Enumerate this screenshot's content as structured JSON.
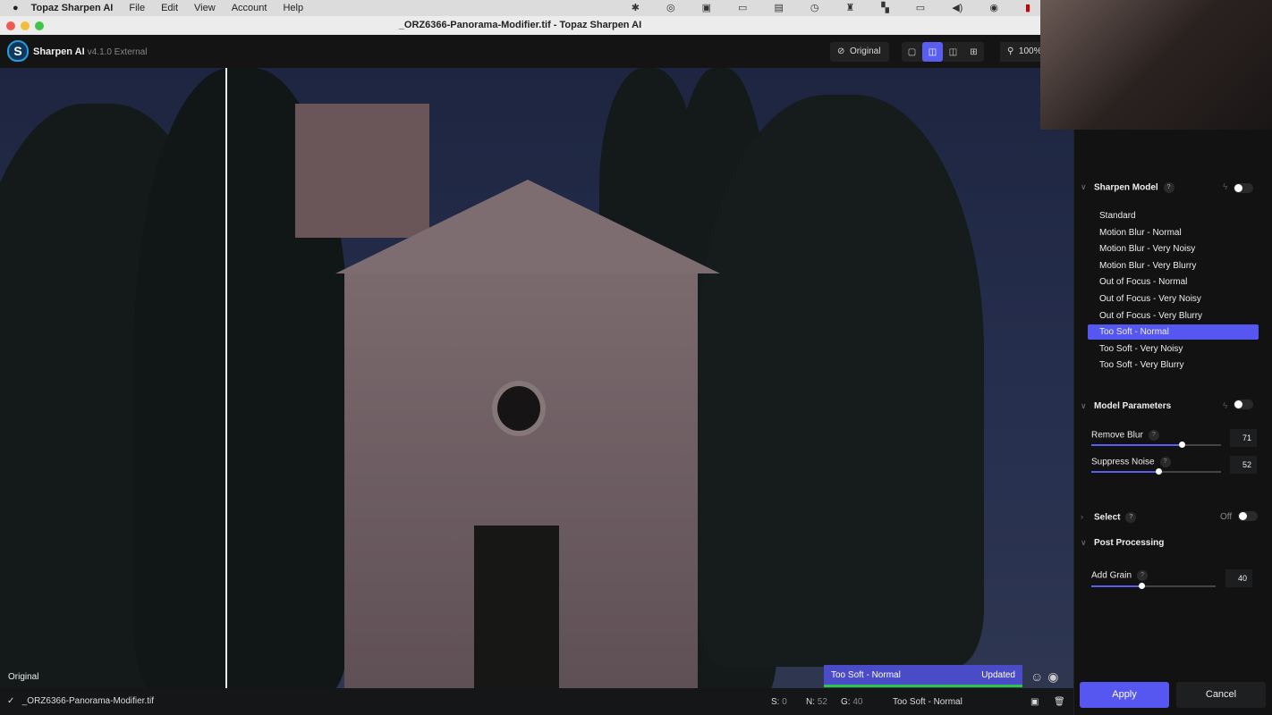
{
  "menubar": {
    "app": "Topaz Sharpen AI",
    "items": [
      "File",
      "Edit",
      "View",
      "Account",
      "Help"
    ]
  },
  "window": {
    "title": "_ORZ6366-Panorama-Modifier.tif - Topaz Sharpen AI"
  },
  "header": {
    "brand": "Sharpen AI",
    "version": "v4.1.0 External",
    "original_label": "Original",
    "zoom": "100%"
  },
  "image": {
    "label": "Original"
  },
  "preview_status": {
    "model": "Too Soft - Normal",
    "state": "Updated"
  },
  "bottombar": {
    "filename": "_ORZ6366-Panorama-Modifier.tif",
    "s_label": "S:",
    "s": "0",
    "n_label": "N:",
    "n": "52",
    "g_label": "G:",
    "g": "40",
    "model": "Too Soft - Normal"
  },
  "panel": {
    "sharpen_model": {
      "title": "Sharpen Model",
      "help": "?",
      "models": [
        "Standard",
        "Motion Blur - Normal",
        "Motion Blur - Very Noisy",
        "Motion Blur - Very Blurry",
        "Out of Focus - Normal",
        "Out of Focus - Very Noisy",
        "Out of Focus - Very Blurry",
        "Too Soft - Normal",
        "Too Soft - Very Noisy",
        "Too Soft - Very Blurry"
      ],
      "selected": "Too Soft - Normal"
    },
    "model_parameters": {
      "title": "Model Parameters",
      "remove_blur": {
        "label": "Remove Blur",
        "value": "71",
        "help": "?"
      },
      "suppress_noise": {
        "label": "Suppress Noise",
        "value": "52",
        "help": "?"
      }
    },
    "select": {
      "title": "Select",
      "help": "?",
      "state": "Off"
    },
    "post_processing": {
      "title": "Post Processing",
      "add_grain": {
        "label": "Add Grain",
        "value": "40",
        "help": "?"
      }
    }
  },
  "actions": {
    "apply": "Apply",
    "cancel": "Cancel"
  },
  "colors": {
    "accent": "#5557f0",
    "updated_bar": "#2ec44a"
  }
}
